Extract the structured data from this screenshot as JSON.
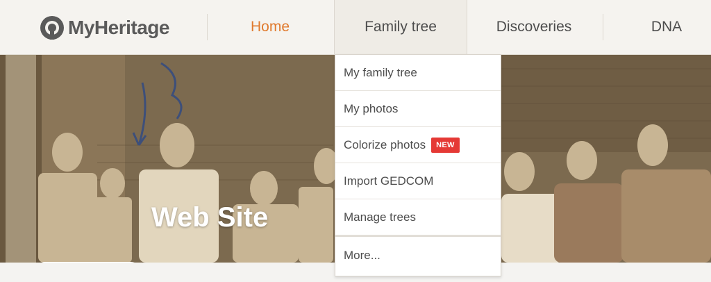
{
  "header": {
    "logo_text": "MyHeritage",
    "nav": [
      {
        "label": "Home"
      },
      {
        "label": "Family tree"
      },
      {
        "label": "Discoveries"
      },
      {
        "label": "DNA"
      }
    ],
    "colors": {
      "active": "#e07a2e",
      "text": "#4d4d4d",
      "bar": "#f5f3ef"
    }
  },
  "dropdown": {
    "items": [
      {
        "label": "My family tree"
      },
      {
        "label": "My photos"
      },
      {
        "label": "Colorize photos",
        "badge": "NEW"
      },
      {
        "label": "Import GEDCOM"
      },
      {
        "label": "Manage trees"
      },
      {
        "label": "More..."
      }
    ],
    "badge_color": "#e53935"
  },
  "hero": {
    "title": "Web Site"
  }
}
